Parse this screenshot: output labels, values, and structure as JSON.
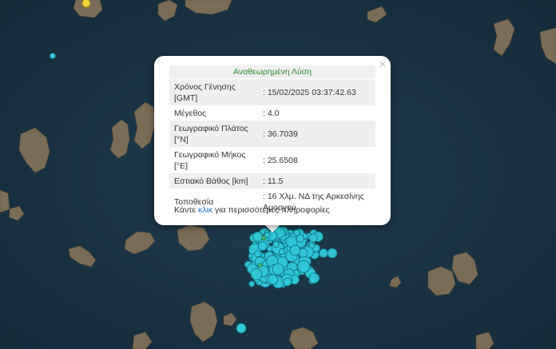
{
  "popup": {
    "title": "Αναθεωρημένη Λύση",
    "close_symbol": "×",
    "rows": [
      {
        "label": "Χρόνος Γένησης [GMT]",
        "value": ": 15/02/2025 03:37:42.63"
      },
      {
        "label": "Μέγεθος",
        "value": ": 4.0"
      },
      {
        "label": "Γεωγραφικό Πλάτος [°N]",
        "value": ": 36.7039"
      },
      {
        "label": "Γεωγραφικό Μήκος [°E]",
        "value": ": 25.6508"
      },
      {
        "label": "Εστιακό Βάθος [km]",
        "value": ": 11.5"
      },
      {
        "label": "Τοποθεσία",
        "value": ": 16 Χλμ. ΝΔ της Αρκεσίνης Αμοργού"
      }
    ],
    "more_prefix": "Κάντε ",
    "more_link": "κλικ",
    "more_suffix": " για περισσότερες πληροφορίες"
  },
  "colors": {
    "sea": "#1a3547",
    "land": "#7a6a52",
    "quake_fill": "#2fc8d8",
    "quake_stroke": "#0e6f80",
    "quake_recent": "#3cb371",
    "marker_yellow": "#f2d43a",
    "title_green": "#2e8b2e",
    "link_blue": "#1a73c8"
  },
  "icons": {
    "close": "close-icon",
    "earthquake": "earthquake-marker-icon"
  }
}
